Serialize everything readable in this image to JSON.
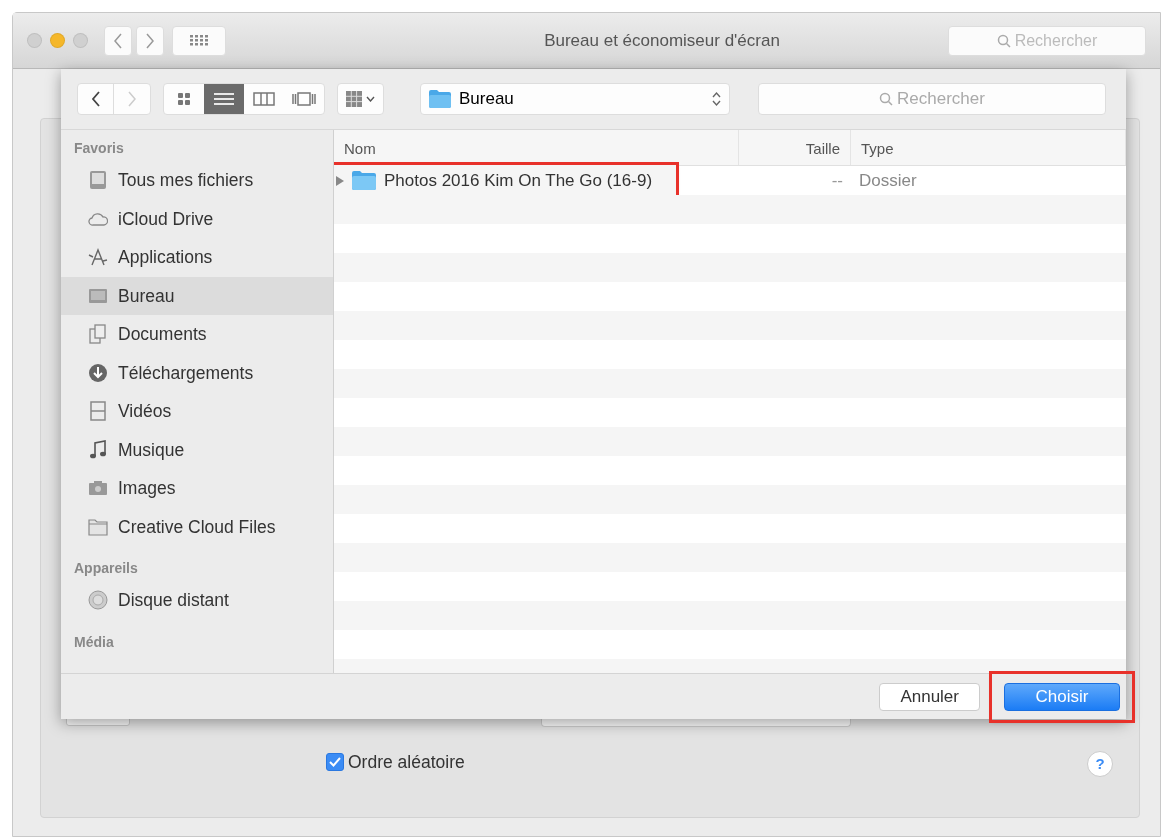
{
  "window": {
    "title": "Bureau et économiseur d'écran",
    "search_placeholder": "Rechercher"
  },
  "dialog": {
    "view_modes": [
      {
        "selected": false
      },
      {
        "selected": true
      },
      {
        "selected": false
      },
      {
        "selected": false
      }
    ],
    "location": "Bureau",
    "search_placeholder": "Rechercher",
    "sidebar": [
      {
        "heading": "Favoris",
        "items": [
          {
            "label": "Tous mes fichiers",
            "selected": false
          },
          {
            "label": "iCloud Drive",
            "selected": false
          },
          {
            "label": "Applications",
            "selected": false
          },
          {
            "label": "Bureau",
            "selected": true
          },
          {
            "label": "Documents",
            "selected": false
          },
          {
            "label": "Téléchargements",
            "selected": false
          },
          {
            "label": "Vidéos",
            "selected": false
          },
          {
            "label": "Musique",
            "selected": false
          },
          {
            "label": "Images",
            "selected": false
          },
          {
            "label": "Creative Cloud Files",
            "selected": false
          }
        ]
      },
      {
        "heading": "Appareils",
        "items": [
          {
            "label": "Disque distant",
            "selected": false
          }
        ]
      },
      {
        "heading": "Média"
      }
    ],
    "columns": [
      "Nom",
      "Taille",
      "Type"
    ],
    "rows": [
      {
        "name": "Photos 2016 Kim On The Go (16-9)",
        "size": "--",
        "type": "Dossier",
        "annotated": true
      }
    ],
    "buttons": [
      {
        "label": "Annuler",
        "kind": "cancel",
        "annotated": false
      },
      {
        "label": "Choisir",
        "kind": "default",
        "annotated": true
      }
    ]
  },
  "background": {
    "checkbox": {
      "label": "Ordre aléatoire",
      "checked": true
    },
    "help_label": "?"
  }
}
